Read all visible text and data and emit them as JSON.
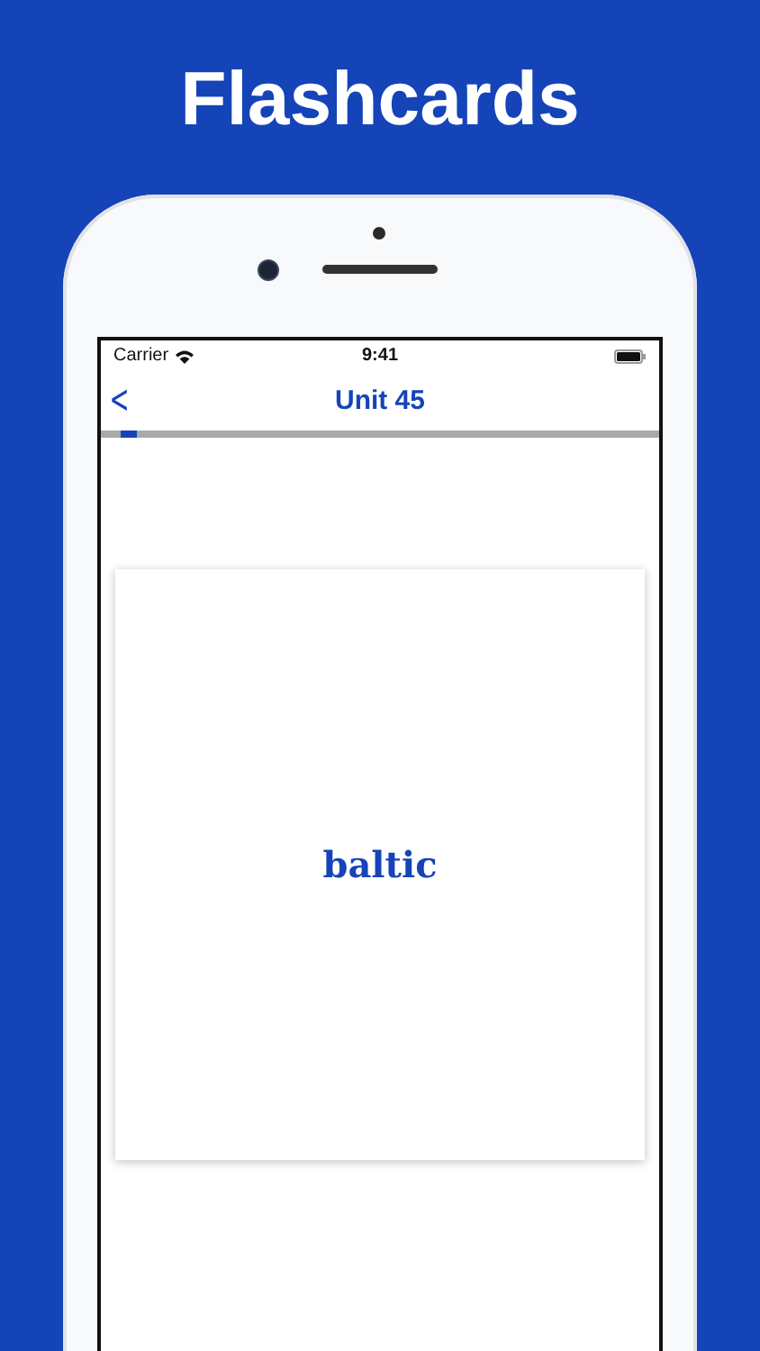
{
  "headline": "Flashcards",
  "status_bar": {
    "carrier": "Carrier",
    "time": "9:41"
  },
  "nav": {
    "back": "<",
    "title": "Unit 45"
  },
  "progress": {
    "level": 0.03
  },
  "card": {
    "word": "baltic"
  }
}
